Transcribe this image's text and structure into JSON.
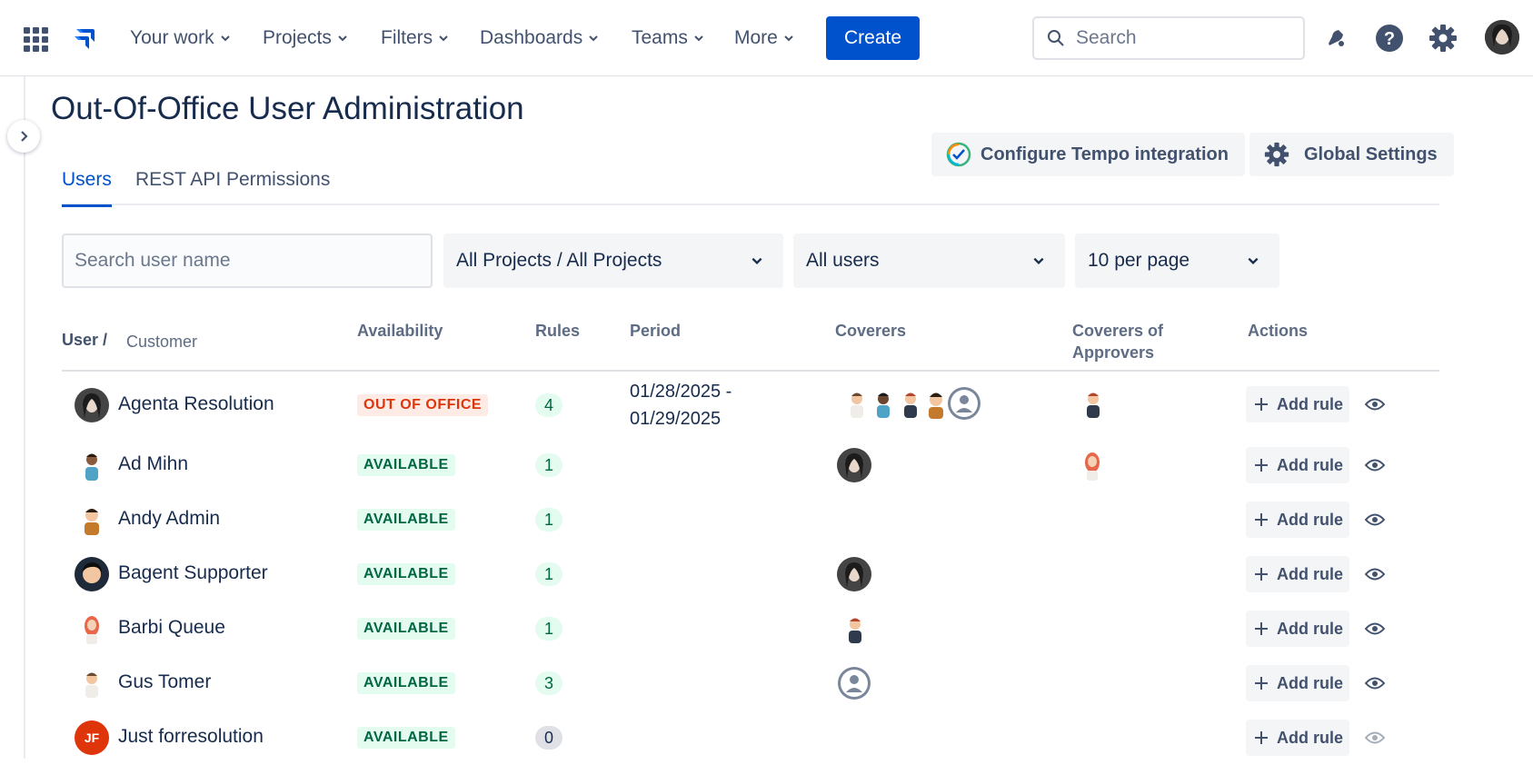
{
  "nav": {
    "items": [
      {
        "label": "Your work"
      },
      {
        "label": "Projects"
      },
      {
        "label": "Filters"
      },
      {
        "label": "Dashboards"
      },
      {
        "label": "Teams"
      },
      {
        "label": "More"
      }
    ],
    "create_label": "Create",
    "search_placeholder": "Search"
  },
  "page": {
    "title": "Out-Of-Office User Administration",
    "configure_tempo_label": "Configure Tempo integration",
    "global_settings_label": "Global Settings",
    "tabs": [
      {
        "label": "Users",
        "active": true
      },
      {
        "label": "REST API Permissions",
        "active": false
      }
    ]
  },
  "filters": {
    "search_placeholder": "Search user name",
    "projects_value": "All Projects / All Projects",
    "users_value": "All users",
    "per_page_value": "10 per page"
  },
  "table": {
    "headers": {
      "user": "User /",
      "customer": "Customer",
      "availability": "Availability",
      "rules": "Rules",
      "period": "Period",
      "coverers": "Coverers",
      "coverers_of_approvers": "Coverers of Approvers",
      "actions": "Actions"
    },
    "add_rule_label": "Add rule",
    "rows": [
      {
        "name": "Agenta Resolution",
        "availability": "OUT OF OFFICE",
        "rules": "4",
        "period_start": "01/28/2025 -",
        "period_end": "01/29/2025"
      },
      {
        "name": "Ad Mihn",
        "availability": "AVAILABLE",
        "rules": "1"
      },
      {
        "name": "Andy Admin",
        "availability": "AVAILABLE",
        "rules": "1"
      },
      {
        "name": "Bagent Supporter",
        "availability": "AVAILABLE",
        "rules": "1"
      },
      {
        "name": "Barbi Queue",
        "availability": "AVAILABLE",
        "rules": "1"
      },
      {
        "name": "Gus Tomer",
        "availability": "AVAILABLE",
        "rules": "3"
      },
      {
        "name": "Just forresolution",
        "availability": "AVAILABLE",
        "rules": "0",
        "initials": "JF"
      }
    ]
  },
  "colors": {
    "brand": "#0052cc",
    "available": "#006644",
    "out_of_office": "#de350b"
  }
}
